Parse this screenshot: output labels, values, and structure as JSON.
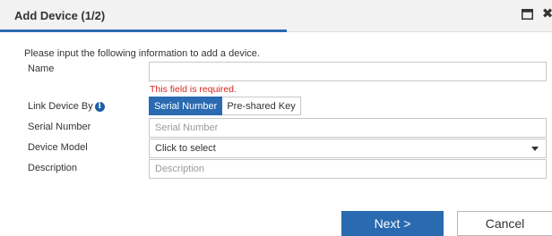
{
  "dialog": {
    "title": "Add Device (1/2)",
    "intro": "Please input the following information to add a device.",
    "colors": {
      "accent": "#2a6ab0",
      "error": "#d9261c",
      "header_bg": "#f2f2f2"
    }
  },
  "header_icons": {
    "maximize": "window-maximize-icon",
    "close": "close-icon",
    "close_glyph": "✖"
  },
  "form": {
    "name": {
      "label": "Name",
      "value": "",
      "error": "This field is required."
    },
    "link_device_by": {
      "label": "Link Device By",
      "info_icon": "info-icon",
      "info_glyph": "i",
      "options": [
        "Serial Number",
        "Pre-shared Key"
      ],
      "selected": "Serial Number"
    },
    "serial_number": {
      "label": "Serial Number",
      "placeholder": "Serial Number",
      "value": ""
    },
    "device_model": {
      "label": "Device Model",
      "selected_text": "Click to select"
    },
    "description": {
      "label": "Description",
      "placeholder": "Description",
      "value": ""
    }
  },
  "buttons": {
    "next": "Next >",
    "cancel": "Cancel"
  }
}
